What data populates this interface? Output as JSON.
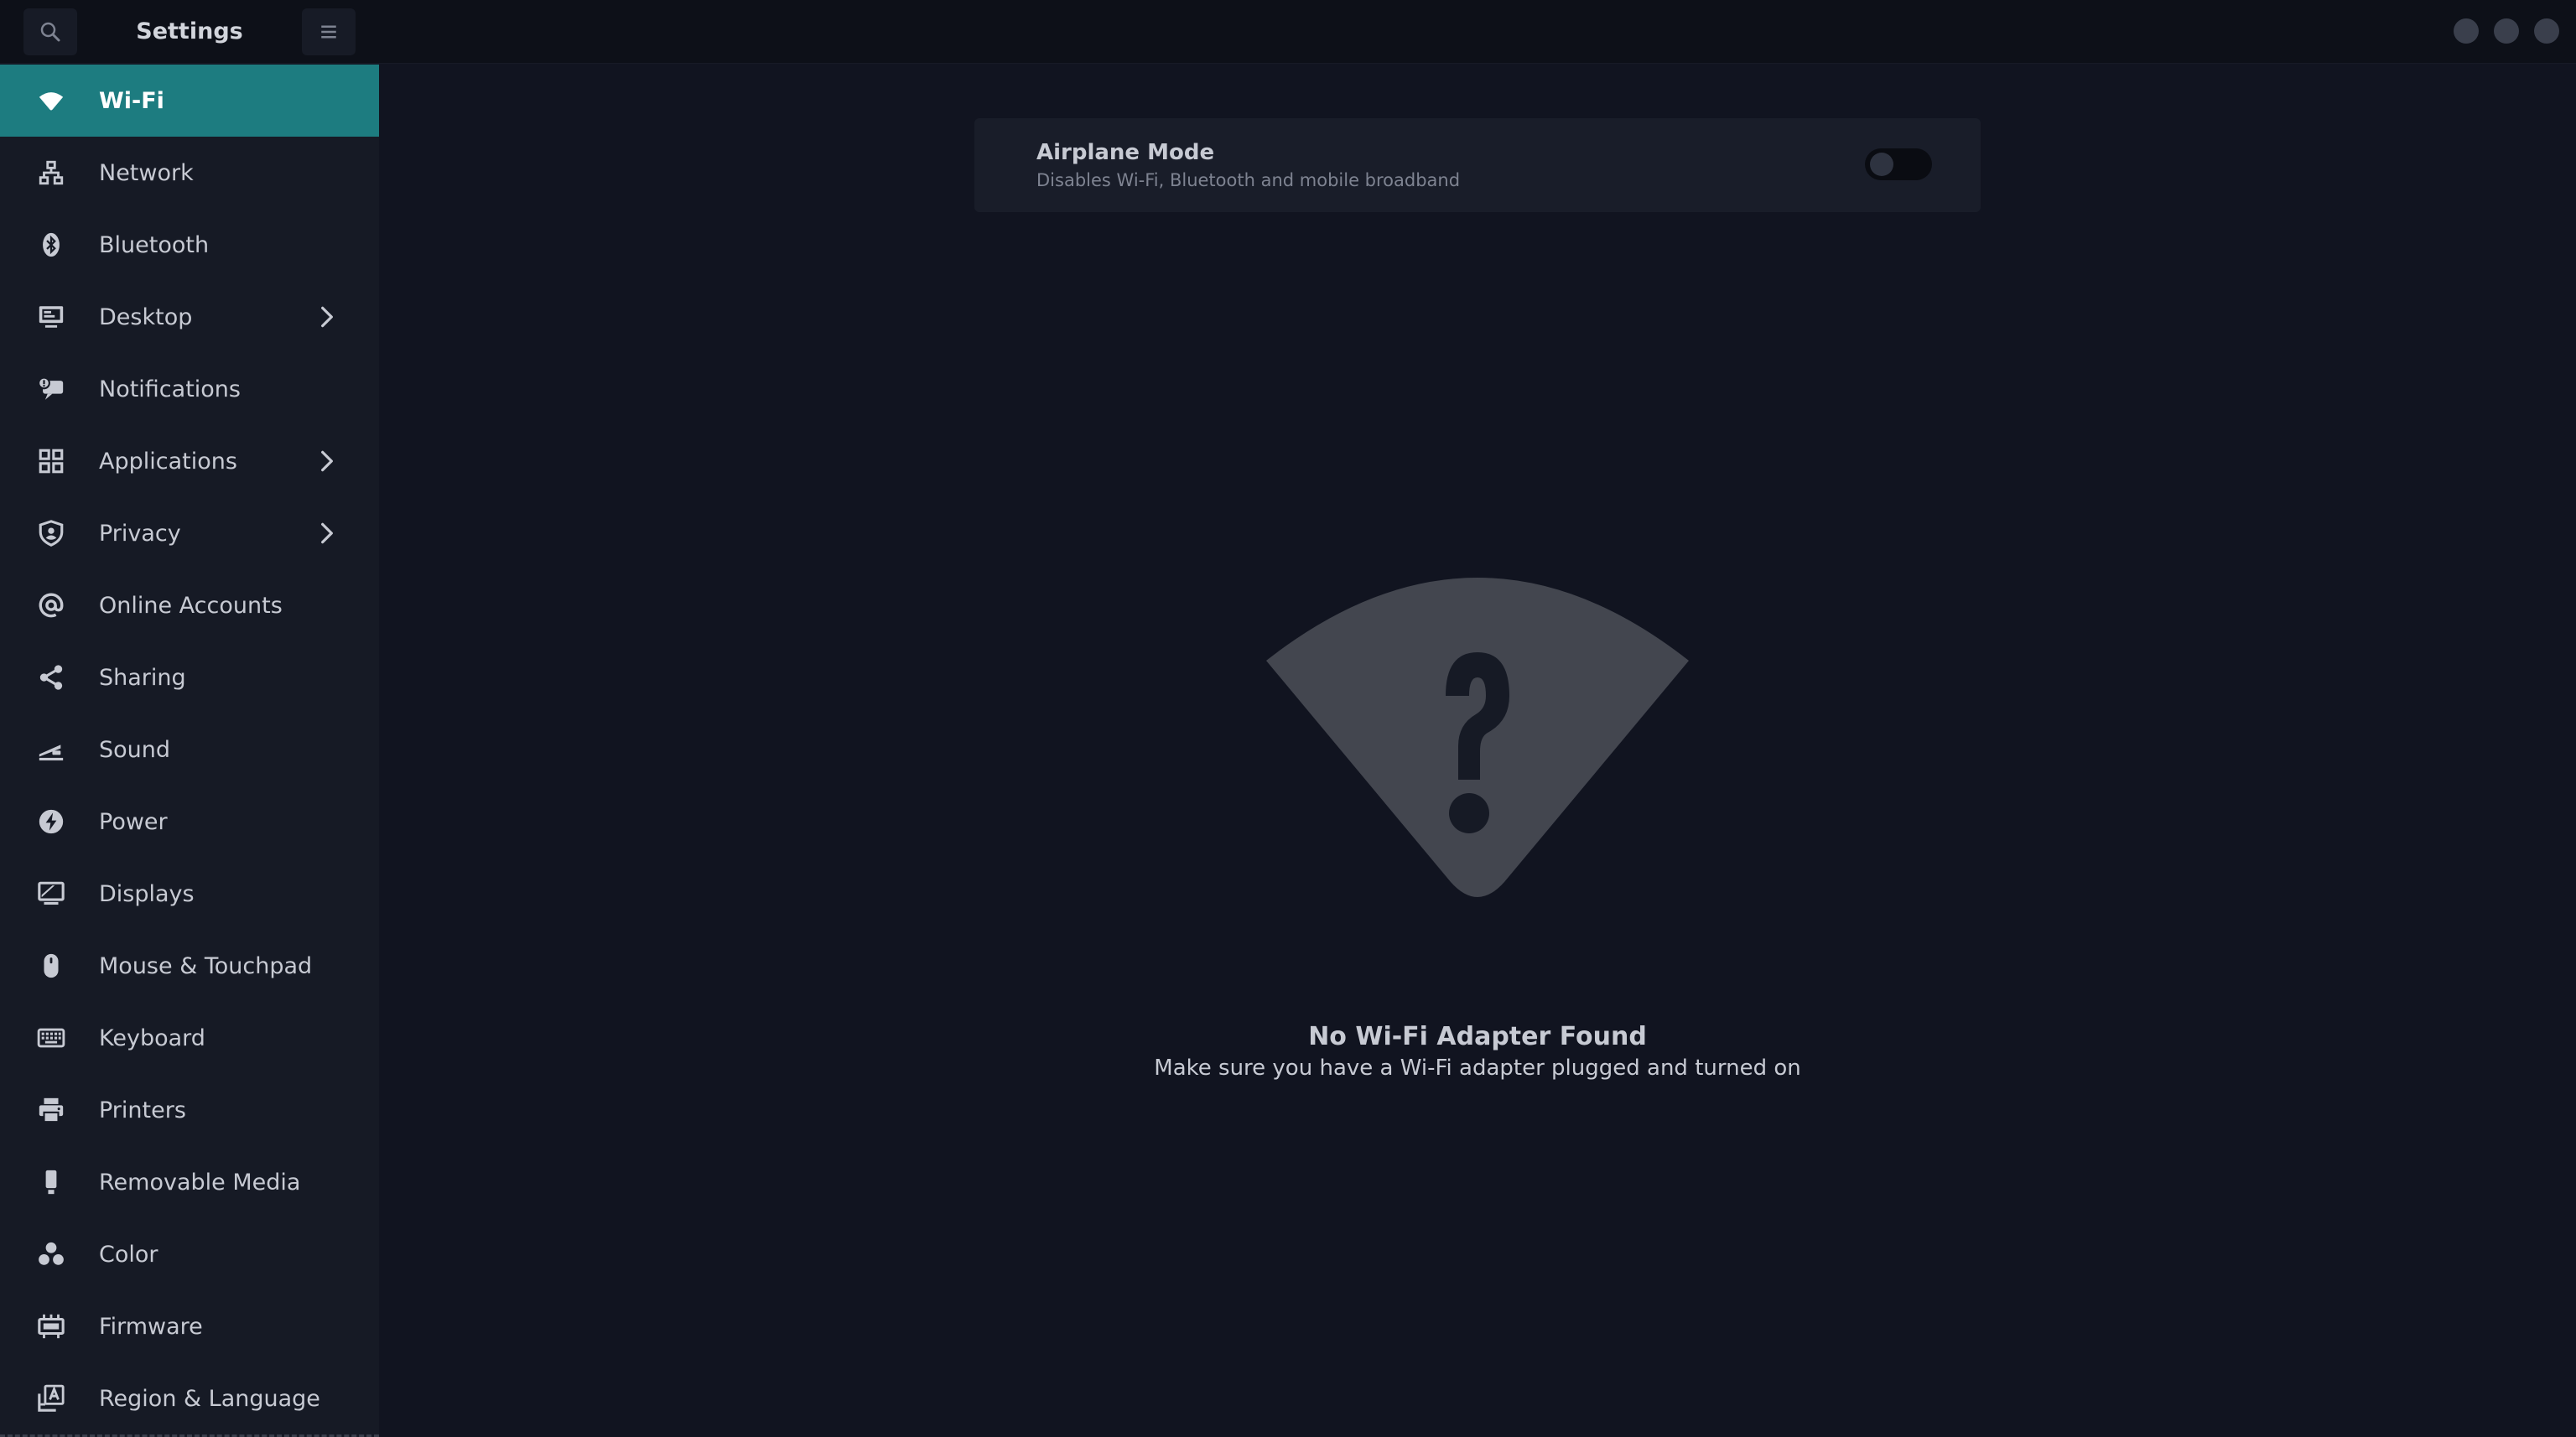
{
  "window": {
    "title": "Settings"
  },
  "header": {
    "search_icon": "search-icon",
    "menu_icon": "hamburger-menu-icon"
  },
  "sidebar": {
    "items": [
      {
        "label": "Wi-Fi",
        "icon": "wifi-icon",
        "active": true
      },
      {
        "label": "Network",
        "icon": "network-icon"
      },
      {
        "label": "Bluetooth",
        "icon": "bluetooth-icon"
      },
      {
        "label": "Desktop",
        "icon": "desktop-icon",
        "has_submenu": true
      },
      {
        "label": "Notifications",
        "icon": "notifications-icon"
      },
      {
        "label": "Applications",
        "icon": "applications-grid-icon",
        "has_submenu": true
      },
      {
        "label": "Privacy",
        "icon": "privacy-shield-icon",
        "has_submenu": true
      },
      {
        "label": "Online Accounts",
        "icon": "at-sign-icon"
      },
      {
        "label": "Sharing",
        "icon": "share-icon"
      },
      {
        "label": "Sound",
        "icon": "sound-icon"
      },
      {
        "label": "Power",
        "icon": "power-bolt-icon"
      },
      {
        "label": "Displays",
        "icon": "displays-icon"
      },
      {
        "label": "Mouse & Touchpad",
        "icon": "mouse-icon"
      },
      {
        "label": "Keyboard",
        "icon": "keyboard-icon"
      },
      {
        "label": "Printers",
        "icon": "printer-icon"
      },
      {
        "label": "Removable Media",
        "icon": "usb-drive-icon"
      },
      {
        "label": "Color",
        "icon": "color-icon"
      },
      {
        "label": "Firmware",
        "icon": "firmware-chip-icon"
      },
      {
        "label": "Region & Language",
        "icon": "region-language-icon"
      }
    ]
  },
  "airplane": {
    "title": "Airplane Mode",
    "subtitle": "Disables Wi-Fi, Bluetooth and mobile broadband",
    "enabled": false
  },
  "empty_state": {
    "icon": "wifi-unknown-icon",
    "title": "No Wi-Fi Adapter Found",
    "subtitle": "Make sure you have a Wi-Fi adapter plugged and turned on"
  },
  "colors": {
    "accent": "#1d7c80",
    "background": "#111420",
    "sidebar": "#161a25",
    "header": "#0d1018"
  }
}
